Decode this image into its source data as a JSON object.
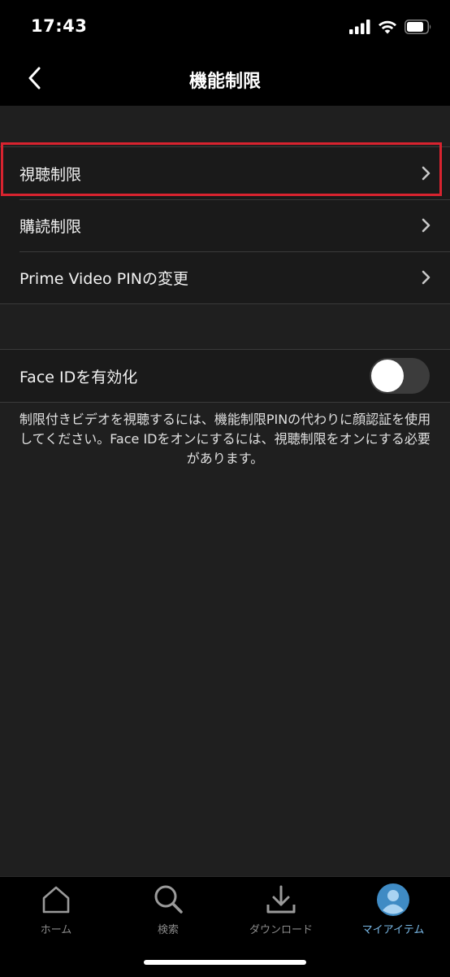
{
  "status_bar": {
    "time": "17:43"
  },
  "nav": {
    "title": "機能制限"
  },
  "menu_group": {
    "items": [
      {
        "label": "視聴制限"
      },
      {
        "label": "購読制限"
      },
      {
        "label": "Prime Video PINの変更"
      }
    ]
  },
  "face_id": {
    "label": "Face IDを有効化",
    "enabled": false,
    "note": "制限付きビデオを視聴するには、機能制限PINの代わりに顔認証を使用してください。Face IDをオンにするには、視聴制限をオンにする必要があります。"
  },
  "tabs": [
    {
      "label": "ホーム",
      "icon": "home-icon"
    },
    {
      "label": "検索",
      "icon": "search-icon"
    },
    {
      "label": "ダウンロード",
      "icon": "download-icon"
    },
    {
      "label": "マイアイテム",
      "icon": "avatar-icon",
      "active": true
    }
  ],
  "colors": {
    "highlight": "#d8232f",
    "active_tab": "#79b8e6"
  }
}
